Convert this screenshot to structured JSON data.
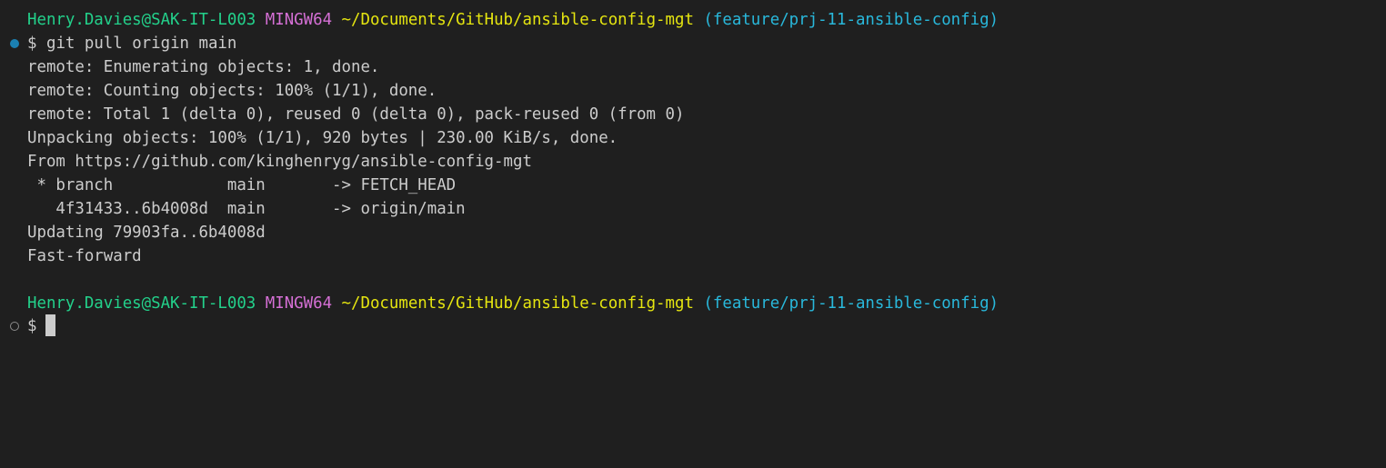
{
  "prompt1": {
    "user": "Henry.Davies@SAK-IT-L003",
    "system": "MINGW64",
    "path": "~/Documents/GitHub/ansible-config-mgt",
    "branch": "(feature/prj-11-ansible-config)"
  },
  "command": {
    "symbol": "$",
    "text": "git pull origin main"
  },
  "output": [
    "remote: Enumerating objects: 1, done.",
    "remote: Counting objects: 100% (1/1), done.",
    "remote: Total 1 (delta 0), reused 0 (delta 0), pack-reused 0 (from 0)",
    "Unpacking objects: 100% (1/1), 920 bytes | 230.00 KiB/s, done.",
    "From https://github.com/kinghenryg/ansible-config-mgt",
    " * branch            main       -> FETCH_HEAD",
    "   4f31433..6b4008d  main       -> origin/main",
    "Updating 79903fa..6b4008d",
    "Fast-forward"
  ],
  "prompt2": {
    "user": "Henry.Davies@SAK-IT-L003",
    "system": "MINGW64",
    "path": "~/Documents/GitHub/ansible-config-mgt",
    "branch": "(feature/prj-11-ansible-config)"
  },
  "input_line": {
    "symbol": "$"
  },
  "colors": {
    "background": "#1f1f1f",
    "text": "#cccccc",
    "user": "#23d18b",
    "system": "#d670d6",
    "path": "#e5e510",
    "branch": "#29b8db",
    "success_marker": "#1b80b2",
    "pending_marker": "#8b8b8b"
  },
  "icons": {
    "command_marker_done": "success-dot-icon",
    "command_marker_pending": "pending-circle-icon"
  }
}
